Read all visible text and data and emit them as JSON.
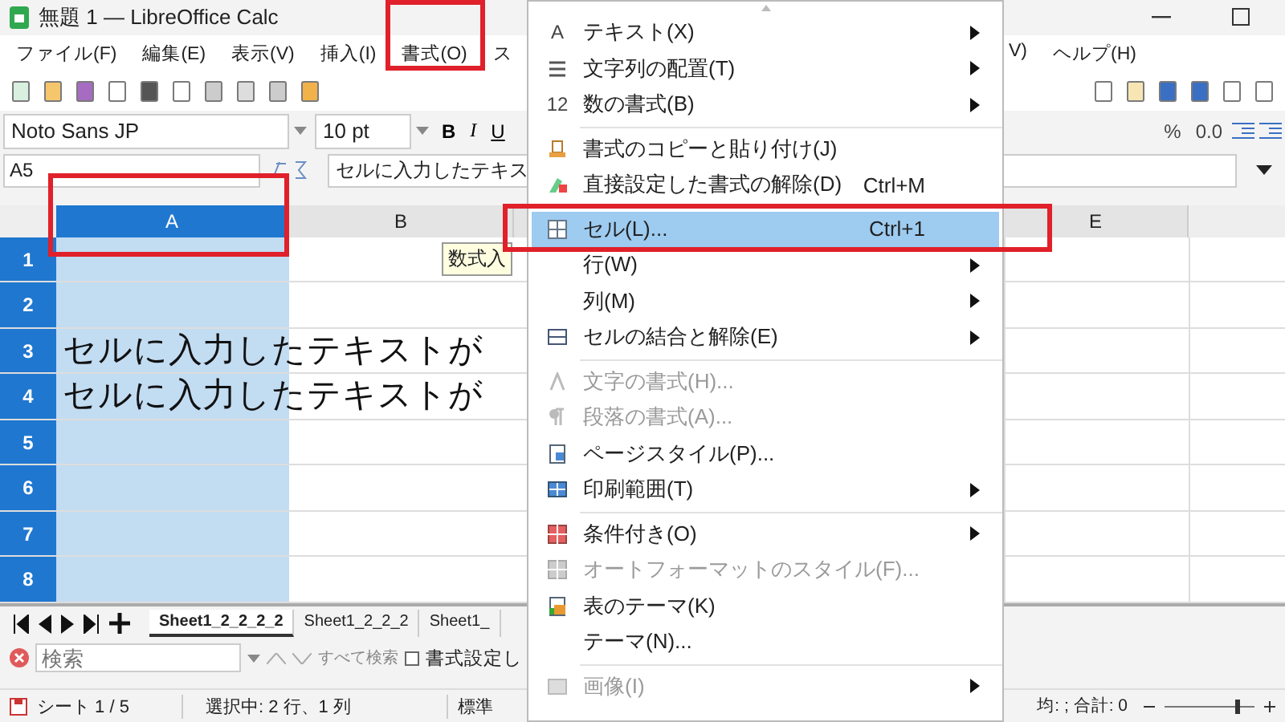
{
  "window": {
    "title": "無題 1 — LibreOffice Calc"
  },
  "menubar": {
    "left": [
      "ファイル(F)",
      "編集(E)",
      "表示(V)",
      "挿入(I)",
      "書式(O)",
      "ス"
    ],
    "right": [
      "V)",
      "ヘルプ(H)"
    ]
  },
  "format_toolbar": {
    "font": "Noto Sans JP",
    "size": "10 pt",
    "styles": [
      "B",
      "I",
      "U"
    ],
    "number_buttons": [
      "%",
      "0.0"
    ]
  },
  "formula_bar": {
    "cell_ref": "A5",
    "content": "セルに入力したテキス"
  },
  "sheet": {
    "columns": [
      {
        "label": "A",
        "selected": true
      },
      {
        "label": "B",
        "selected": false
      },
      {
        "label": "E",
        "selected": false
      }
    ],
    "rows": [
      {
        "number": "1",
        "selected": true
      },
      {
        "number": "2",
        "selected": true
      },
      {
        "number": "3",
        "selected": true,
        "text": "セルに入力したテキストが"
      },
      {
        "number": "4",
        "selected": true,
        "text": "セルに入力したテキストが"
      },
      {
        "number": "5",
        "selected": true
      },
      {
        "number": "6",
        "selected": true
      },
      {
        "number": "7",
        "selected": true
      },
      {
        "number": "8",
        "selected": true
      }
    ],
    "tooltip": "数式入"
  },
  "sheet_tabs": [
    {
      "label": "Sheet1_2_2_2_2",
      "selected": true
    },
    {
      "label": "Sheet1_2_2_2",
      "selected": false
    },
    {
      "label": "Sheet1_",
      "selected": false
    }
  ],
  "find_bar": {
    "placeholder": "検索",
    "find_all": "すべて検索",
    "format_option": "書式設定し",
    "checked": false
  },
  "status_bar": {
    "sheet": "シート 1 / 5",
    "selection": "選択中: 2 行、1 列",
    "style": "標準",
    "summary": "均: ; 合計: 0",
    "zoom_slider": {
      "level": 0.8
    }
  },
  "format_menu": {
    "items": [
      {
        "icon_text": "A",
        "label": "テキスト(X)",
        "submenu": true,
        "disabled": false,
        "selected": false,
        "separator_after": false
      },
      {
        "label": "文字列の配置(T)",
        "submenu": true,
        "disabled": false,
        "selected": false,
        "separator_after": false
      },
      {
        "icon_text": "12",
        "label": "数の書式(B)",
        "submenu": true,
        "disabled": false,
        "selected": false,
        "separator_after": true
      },
      {
        "label": "書式のコピーと貼り付け(J)",
        "submenu": false,
        "disabled": false,
        "selected": false,
        "separator_after": false
      },
      {
        "label": "直接設定した書式の解除(D)",
        "shortcut": "Ctrl+M",
        "submenu": false,
        "disabled": false,
        "selected": false,
        "separator_after": true
      },
      {
        "label": "セル(L)...",
        "shortcut": "Ctrl+1",
        "submenu": false,
        "disabled": false,
        "selected": true,
        "separator_after": false
      },
      {
        "label": "行(W)",
        "submenu": true,
        "disabled": false,
        "selected": false,
        "separator_after": false
      },
      {
        "label": "列(M)",
        "submenu": true,
        "disabled": false,
        "selected": false,
        "separator_after": false
      },
      {
        "label": "セルの結合と解除(E)",
        "submenu": true,
        "disabled": false,
        "selected": false,
        "separator_after": true
      },
      {
        "label": "文字の書式(H)...",
        "submenu": false,
        "disabled": true,
        "selected": false,
        "separator_after": false
      },
      {
        "label": "段落の書式(A)...",
        "submenu": false,
        "disabled": true,
        "selected": false,
        "separator_after": false
      },
      {
        "label": "ページスタイル(P)...",
        "submenu": false,
        "disabled": false,
        "selected": false,
        "separator_after": false
      },
      {
        "label": "印刷範囲(T)",
        "submenu": true,
        "disabled": false,
        "selected": false,
        "separator_after": true
      },
      {
        "label": "条件付き(O)",
        "submenu": true,
        "disabled": false,
        "selected": false,
        "separator_after": false
      },
      {
        "label": "オートフォーマットのスタイル(F)...",
        "submenu": false,
        "disabled": true,
        "selected": false,
        "separator_after": false
      },
      {
        "label": "表のテーマ(K)",
        "submenu": false,
        "disabled": false,
        "selected": false,
        "separator_after": false
      },
      {
        "label": "テーマ(N)...",
        "submenu": false,
        "disabled": false,
        "selected": false,
        "separator_after": true
      },
      {
        "label": "画像(I)",
        "submenu": true,
        "disabled": true,
        "selected": false,
        "separator_after": false
      }
    ]
  }
}
